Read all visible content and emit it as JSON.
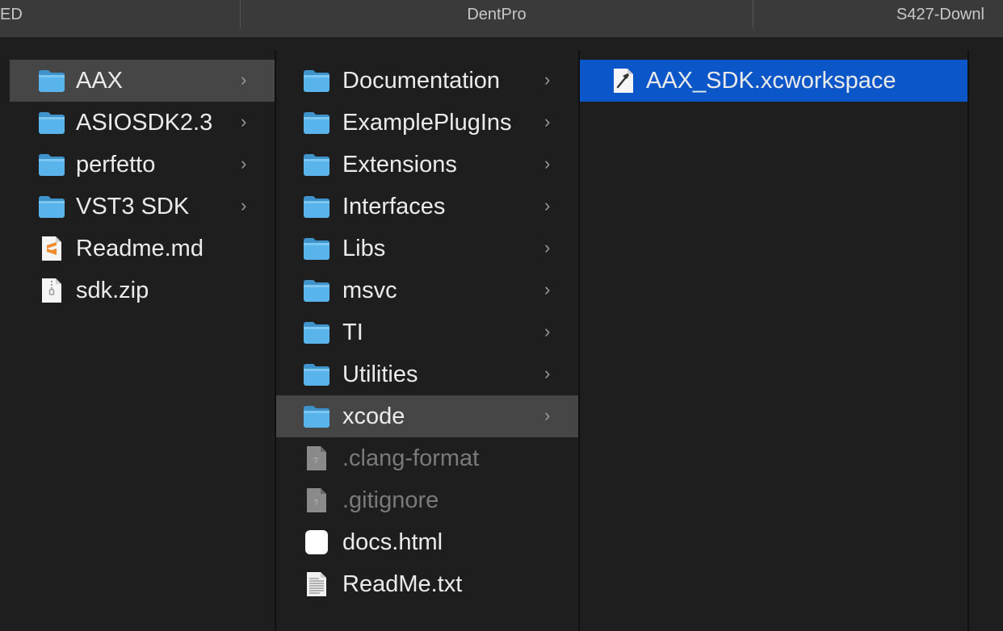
{
  "tabs": [
    {
      "label": "ED"
    },
    {
      "label": "DentPro"
    },
    {
      "label": "S427-Downl"
    }
  ],
  "columns": [
    {
      "items": [
        {
          "label": "AAX",
          "icon": "folder-icon",
          "has_children": true,
          "state": "selected-inactive"
        },
        {
          "label": "ASIOSDK2.3",
          "icon": "folder-icon",
          "has_children": true
        },
        {
          "label": "perfetto",
          "icon": "folder-icon",
          "has_children": true
        },
        {
          "label": "VST3 SDK",
          "icon": "folder-icon",
          "has_children": true
        },
        {
          "label": "Readme.md",
          "icon": "sublime-text-file-icon",
          "has_children": false
        },
        {
          "label": "sdk.zip",
          "icon": "zip-file-icon",
          "has_children": false
        }
      ]
    },
    {
      "items": [
        {
          "label": "Documentation",
          "icon": "folder-icon",
          "has_children": true
        },
        {
          "label": "ExamplePlugIns",
          "icon": "folder-icon",
          "has_children": true
        },
        {
          "label": "Extensions",
          "icon": "folder-icon",
          "has_children": true
        },
        {
          "label": "Interfaces",
          "icon": "folder-icon",
          "has_children": true
        },
        {
          "label": "Libs",
          "icon": "folder-icon",
          "has_children": true
        },
        {
          "label": "msvc",
          "icon": "folder-icon",
          "has_children": true
        },
        {
          "label": "TI",
          "icon": "folder-icon",
          "has_children": true
        },
        {
          "label": "Utilities",
          "icon": "folder-icon",
          "has_children": true
        },
        {
          "label": "xcode",
          "icon": "folder-icon",
          "has_children": true,
          "state": "selected-inactive"
        },
        {
          "label": ".clang-format",
          "icon": "unknown-file-icon",
          "has_children": false,
          "dim": true
        },
        {
          "label": ".gitignore",
          "icon": "unknown-file-icon",
          "has_children": false,
          "dim": true
        },
        {
          "label": "docs.html",
          "icon": "html-file-icon",
          "has_children": false
        },
        {
          "label": "ReadMe.txt",
          "icon": "text-file-icon",
          "has_children": false
        }
      ]
    },
    {
      "items": [
        {
          "label": "AAX_SDK.xcworkspace",
          "icon": "xcode-workspace-icon",
          "has_children": false,
          "state": "selected-active"
        }
      ]
    }
  ],
  "colors": {
    "background": "#1e1e1e",
    "tabbar": "#3a3a3a",
    "selection_active": "#0b57c9",
    "selection_inactive": "#464646",
    "folder": "#5ab4ec"
  }
}
